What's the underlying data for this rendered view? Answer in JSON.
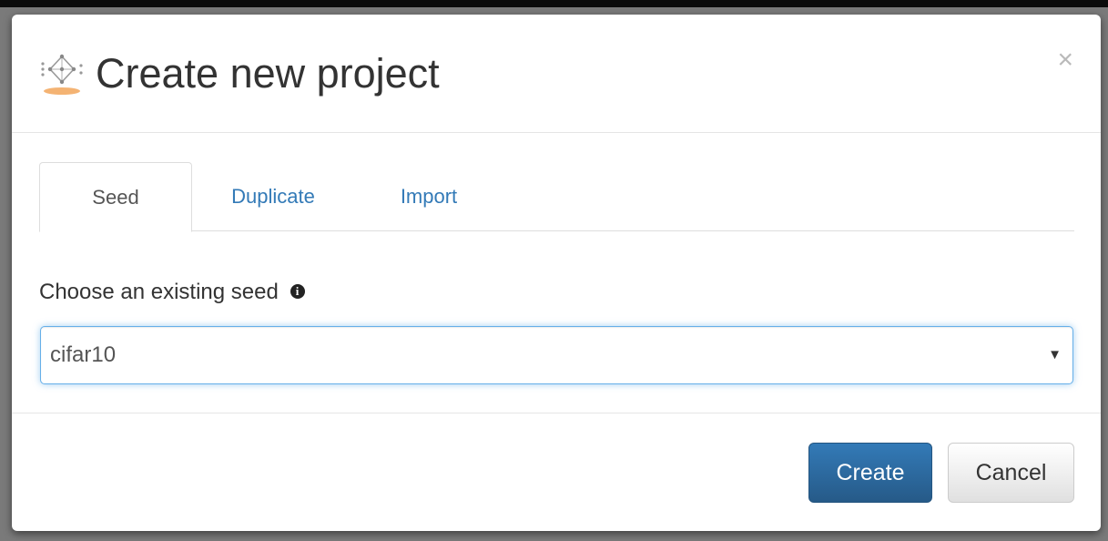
{
  "modal": {
    "title": "Create new project",
    "close_label": "×"
  },
  "tabs": [
    {
      "label": "Seed",
      "active": true
    },
    {
      "label": "Duplicate",
      "active": false
    },
    {
      "label": "Import",
      "active": false
    }
  ],
  "seed_field": {
    "label": "Choose an existing seed",
    "info_icon": "i",
    "selected_value": "cifar10",
    "caret": "▼"
  },
  "footer": {
    "create_label": "Create",
    "cancel_label": "Cancel"
  },
  "colors": {
    "link": "#337ab7",
    "primary": "#337ab7",
    "focus_border": "#66afe9"
  }
}
